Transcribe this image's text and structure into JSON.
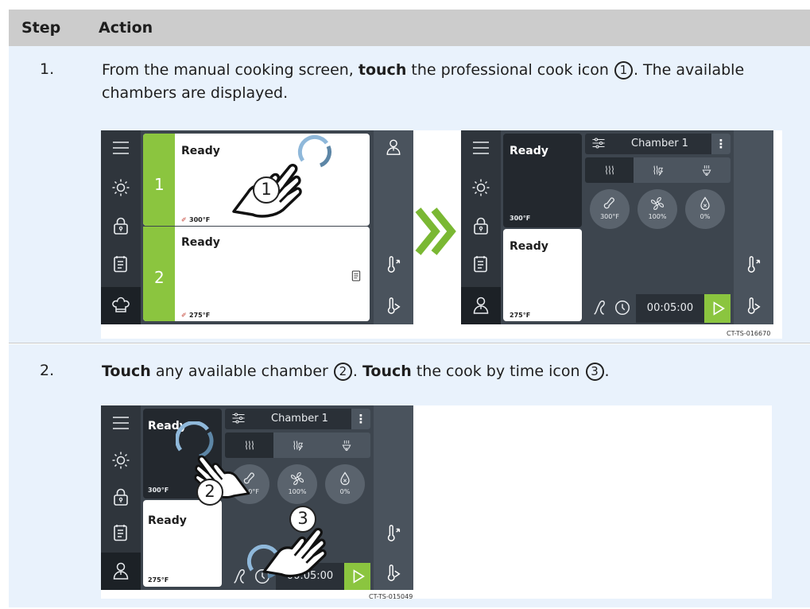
{
  "header": {
    "step": "Step",
    "action": "Action"
  },
  "steps": [
    {
      "num": "1.",
      "text_a": "From the manual cooking screen, ",
      "text_bold": "touch",
      "text_b": " the professional cook icon ",
      "marker": "1",
      "text_c": ". The available chambers are displayed."
    },
    {
      "num": "2.",
      "bold1": "Touch",
      "text_a": " any available chamber ",
      "marker1": "2",
      "text_b": ". ",
      "bold2": "Touch",
      "text_c": " the cook by time icon ",
      "marker2": "3",
      "text_d": "."
    }
  ],
  "screen_a": {
    "chambers": [
      {
        "number": "1",
        "status": "Ready",
        "temp": "300°F"
      },
      {
        "number": "2",
        "status": "Ready",
        "temp": "275°F"
      }
    ]
  },
  "screen_b": {
    "chambers": [
      {
        "status": "Ready",
        "temp": "300°F"
      },
      {
        "status": "Ready",
        "temp": "275°F"
      }
    ],
    "header_title": "Chamber 1",
    "dials": [
      "300°F",
      "100%",
      "0%"
    ],
    "timer": "00:05:00",
    "figure_code": "CT-TS-016670"
  },
  "screen_c": {
    "chambers": [
      {
        "status": "Ready",
        "temp": "300°F"
      },
      {
        "status": "Ready",
        "temp": "275°F"
      }
    ],
    "header_title": "Chamber 1",
    "dials": [
      "300°F",
      "100%",
      "0%"
    ],
    "timer": "00:05:00",
    "figure_code": "CT-TS-015049"
  },
  "callouts": [
    "1",
    "2",
    "3"
  ],
  "icons": [
    "menu-icon",
    "light-icon",
    "lock-icon",
    "recipe-icon",
    "chef-hat-icon",
    "professional-cook-icon",
    "probe-out-icon",
    "probe-in-icon",
    "settings-icon",
    "more-icon",
    "steam-icon",
    "combi-icon",
    "convection-icon",
    "thermometer-icon",
    "fan-icon",
    "humidity-icon",
    "cook-by-probe-icon",
    "cook-by-time-icon",
    "play-icon",
    "double-chevron-icon",
    "touch-hand-icon"
  ],
  "colors": {
    "accent_green": "#8bc53f",
    "header_gray": "#cccccc",
    "row_blue": "#e9f2fc",
    "screen_dark": "#3d454e"
  }
}
